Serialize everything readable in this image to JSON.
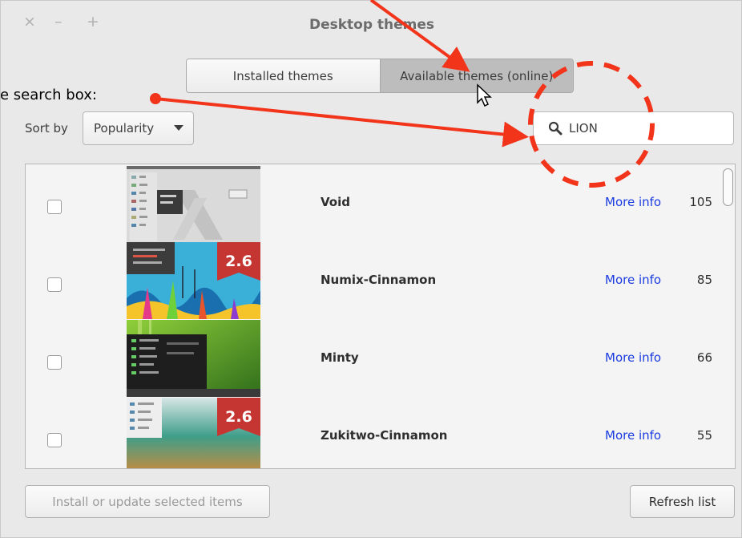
{
  "window": {
    "title": "Desktop themes",
    "close_glyph": "×",
    "minimize_glyph": "–",
    "maximize_glyph": "+"
  },
  "tabs": [
    {
      "label": "Installed themes",
      "active": false
    },
    {
      "label": "Available themes (online)",
      "active": true
    }
  ],
  "sort": {
    "label": "Sort by",
    "value": "Popularity"
  },
  "search": {
    "value": "LION",
    "icon": "search-icon"
  },
  "themes": [
    {
      "name": "Void",
      "link": "More info",
      "score": "105",
      "version_badge": ""
    },
    {
      "name": "Numix-Cinnamon",
      "link": "More info",
      "score": "85",
      "version_badge": "2.6"
    },
    {
      "name": "Minty",
      "link": "More info",
      "score": "66",
      "version_badge": ""
    },
    {
      "name": "Zukitwo-Cinnamon",
      "link": "More info",
      "score": "55",
      "version_badge": "2.6"
    }
  ],
  "buttons": {
    "install": "Install or update selected items",
    "refresh": "Refresh list"
  },
  "annotation": {
    "text": "e search box:",
    "color": "#f2341b"
  }
}
